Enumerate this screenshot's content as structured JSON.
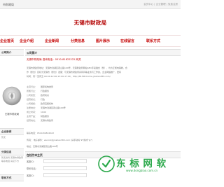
{
  "topbar": {
    "site_name": "市财政局",
    "links": "会员中心 | 企业管理 | 免费注册"
  },
  "header": {
    "title": "无锡市财政局"
  },
  "nav": {
    "items": [
      "企业首页",
      "企业介绍",
      "企业新闻",
      "分类信息",
      "图片展示",
      "在线留言",
      "联系方式"
    ]
  },
  "left": {
    "section_company": "公司简介",
    "company_name": "无锡市财政局",
    "section_news": "企业新闻",
    "section_news_text": "暂无",
    "section_info": "分类信息",
    "info_lines": [
      "暂无资料·无锡市财政局",
      "联系电话·请见下方"
    ],
    "section_contact": "联系方式"
  },
  "main": {
    "section_intro": "公司简介",
    "contact_line": "无锡市财政局 咨询电话：0510-81822222 网关",
    "intro_lines": [
      "无锡市财政局地址：无锡市滨湖区观山路199号，无锡财政局网站SEO手段融合（整）、均为正规电销教，合",
      "作（整合）目标为无锡市（整合）发展：与无锡市财政局具有同等业务与工作的，企业网络推广，更有",
      "时间：周一至周五 09:00-12:00;13:00-17:00，http://81300.home.jinshan365.com/"
    ],
    "info_rows": [
      {
        "k": "主营行业：",
        "v": "国家机构类局"
      },
      {
        "k": "所属行业：",
        "v": "行政服务"
      },
      {
        "k": "公司类型：",
        "v": "政府机关"
      },
      {
        "k": "经营模式：",
        "v": "行政"
      },
      {
        "k": "公司规模：",
        "v": "政府直属机构"
      },
      {
        "k": "注册地址：",
        "v": "无锡市滨湖区观山路199号"
      },
      {
        "k": "成立时间：",
        "v": "1949"
      },
      {
        "k": "主营产品：",
        "v": "财政服务"
      },
      {
        "k": "经营地址：",
        "v": "无锡市财政局"
      }
    ],
    "phone_line": "联系电话：0510-81822222",
    "fax_line": "传真： 电子邮件：wuxicz@jinshan365.com (请手动将\"#\"换成\"@\")",
    "address_line": "地址：无锡市滨湖区观山路199号",
    "section_message": "在线为本主页",
    "message_fields": [
      "客服ID：",
      "联系电话：",
      "客服ID："
    ]
  },
  "watermark": {
    "text": "东 标 网 软",
    "url": "www.dongbiao.com.cn"
  },
  "colors": {
    "accent": "#c40000",
    "watermark": "#2aa84a"
  }
}
